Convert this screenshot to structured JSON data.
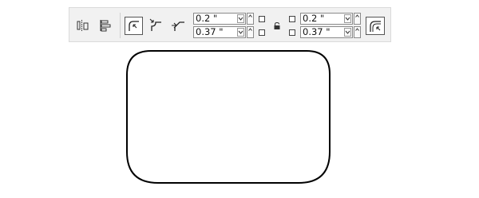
{
  "toolbar": {
    "corner_radius_top_left": "0.2 \"",
    "corner_radius_bottom_left": "0.37 \"",
    "corner_radius_top_right": "0.2 \"",
    "corner_radius_bottom_right": "0.37 \"",
    "tools": [
      "align-horizontal-icon",
      "align-vertical-icon",
      "round-corner-icon",
      "scalloped-corner-icon",
      "chamfered-corner-icon",
      "lock-icon",
      "scale-corners-icon"
    ]
  },
  "canvas": {
    "shape": "rounded-rectangle",
    "stroke_color": "#000000",
    "fill_color": "#ffffff"
  }
}
